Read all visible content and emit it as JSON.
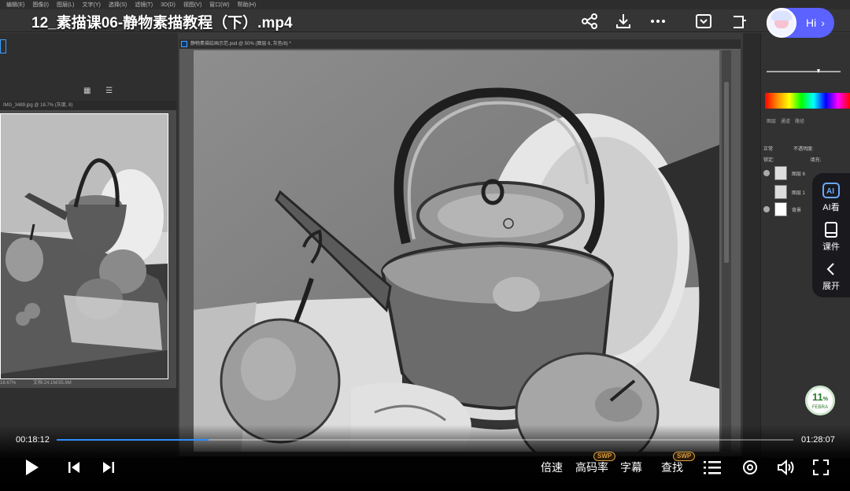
{
  "player": {
    "title": "12_素描课06-静物素描教程（下）.mp4",
    "time_current": "00:18:12",
    "time_total": "01:28:07",
    "progress_fraction": 0.206,
    "accent_color": "#2f8cff",
    "hi_label": "Hi",
    "buttons": {
      "speed": "倍速",
      "quality": "高码率",
      "subtitle": "字幕",
      "search": "查找",
      "swp_badge": "SWP"
    },
    "side_menu": {
      "ai": "AI看",
      "courseware": "课件",
      "expand": "展开"
    },
    "speed_badge": {
      "value": "11",
      "unit": "%",
      "sub": "FEBRA"
    }
  },
  "photoshop": {
    "menu_items": [
      "编辑(E)",
      "图像(I)",
      "图层(L)",
      "文字(Y)",
      "选择(S)",
      "滤镜(T)",
      "3D(D)",
      "视图(V)",
      "窗口(W)",
      "帮助(H)"
    ],
    "canvas_title": "静物素描绘画示范.psd @ 50% (图层 6, 灰色/8) *",
    "photo_title": "IMG_3489.jpg @ 18.7% (灰度, 8)",
    "photo_status_zoom": "18.67%",
    "photo_status_doc": "文档:24.1M/35.9M",
    "layer_tabs": [
      "图层",
      "通道",
      "路径"
    ],
    "blend_mode": "正常",
    "opacity_label": "不透明度:",
    "lock_label": "锁定:",
    "fill_label": "填充:",
    "layers": [
      "图层 6",
      "图层 1",
      "背景"
    ]
  }
}
